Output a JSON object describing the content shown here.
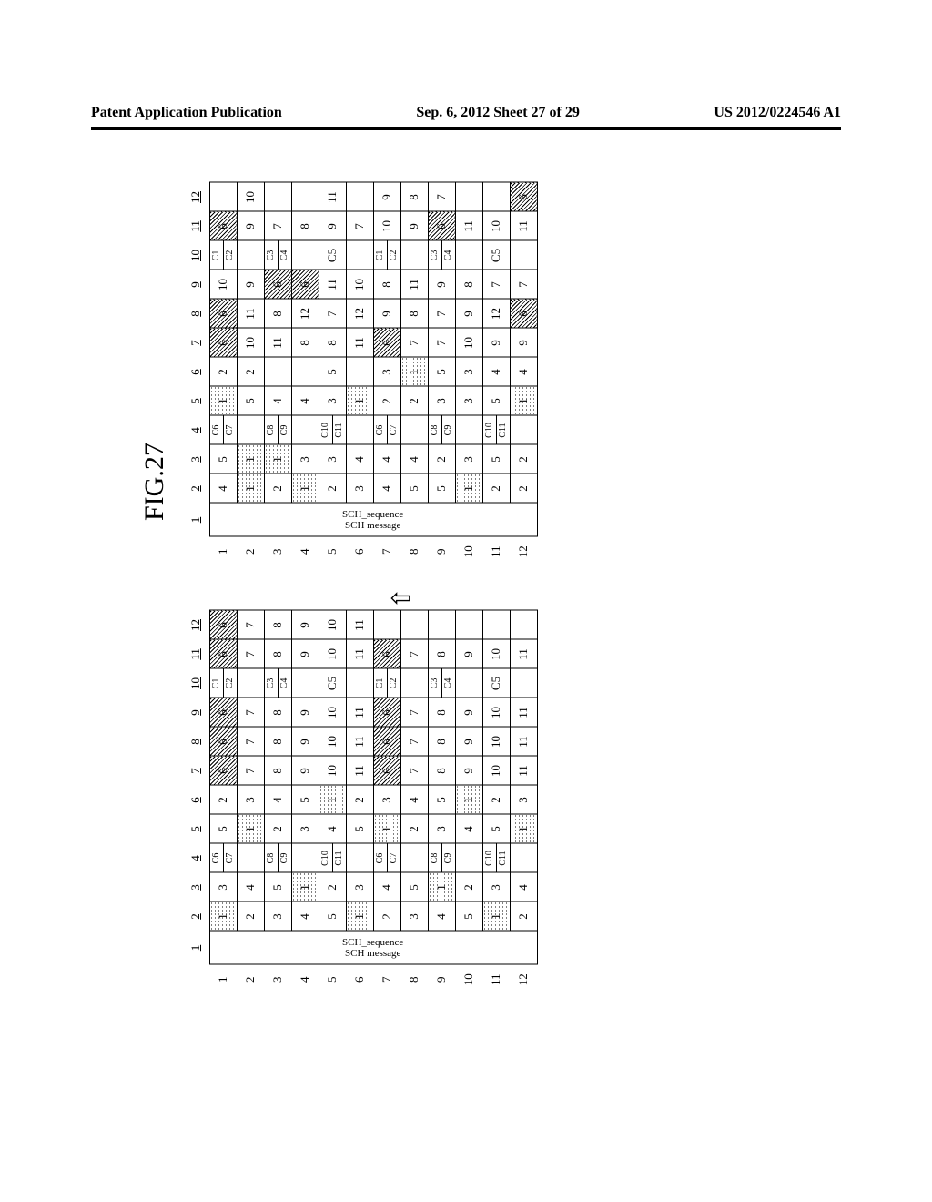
{
  "header": {
    "left": "Patent Application Publication",
    "center": "Sep. 6, 2012   Sheet 27 of 29",
    "right": "US 2012/0224546 A1"
  },
  "figure_label": "FIG.27",
  "arrow_glyph": "⇧",
  "sch_labels": {
    "sequence": "SCH_sequence",
    "message": "SCH message"
  },
  "col_headers": [
    "1",
    "2",
    "3",
    "4",
    "5",
    "6",
    "7",
    "8",
    "9",
    "10",
    "11",
    "12"
  ],
  "row_headers": [
    "1",
    "2",
    "3",
    "4",
    "5",
    "6",
    "7",
    "8",
    "9",
    "10",
    "11",
    "12"
  ],
  "split_col4": [
    "C6",
    "C7",
    "",
    "",
    "C8",
    "C9",
    "",
    "",
    "C10",
    "C11",
    "",
    "",
    "C6",
    "C7",
    "",
    "",
    "C8",
    "C9",
    "",
    "",
    "C10",
    "C11",
    "",
    ""
  ],
  "split_col10": [
    "C1",
    "C2",
    "",
    "",
    "C3",
    "C4",
    "",
    "",
    "C5",
    "",
    "",
    "",
    "C1",
    "C2",
    "",
    "",
    "C3",
    "C4",
    "",
    "",
    "C5",
    "",
    "",
    ""
  ],
  "table_top": {
    "comment": "Lower table in rotated view (first grid from top before arrow)",
    "rows": [
      {
        "c2": "1",
        "c2s": "dotted",
        "c3": "3",
        "c5": "5",
        "c6": "2",
        "c7": "6",
        "c7s": "diag",
        "c8": "6",
        "c8s": "diag",
        "c9": "6",
        "c9s": "diag",
        "c11": "6",
        "c11s": "diag",
        "c12": "6",
        "c12s": "diag"
      },
      {
        "c2": "2",
        "c3": "4",
        "c5": "1",
        "c5s": "dotted",
        "c6": "3",
        "c7": "7",
        "c8": "7",
        "c9": "7",
        "c11": "7",
        "c12": "7"
      },
      {
        "c2": "3",
        "c3": "5",
        "c5": "2",
        "c6": "4",
        "c7": "8",
        "c8": "8",
        "c9": "8",
        "c11": "8",
        "c12": "8"
      },
      {
        "c2": "4",
        "c3": "1",
        "c3s": "dotted",
        "c5": "3",
        "c6": "5",
        "c7": "9",
        "c8": "9",
        "c9": "9",
        "c11": "9",
        "c12": "9"
      },
      {
        "c2": "5",
        "c3": "2",
        "c5": "4",
        "c6": "1",
        "c6s": "dotted",
        "c7": "10",
        "c8": "10",
        "c9": "10",
        "c11": "10",
        "c12": "10"
      },
      {
        "c2": "1",
        "c2s": "dotted",
        "c3": "3",
        "c5": "5",
        "c6": "2",
        "c7": "11",
        "c8": "11",
        "c9": "11",
        "c11": "11",
        "c12": "11"
      },
      {
        "c2": "2",
        "c3": "4",
        "c5": "1",
        "c5s": "dotted",
        "c6": "3",
        "c7": "6",
        "c7s": "diag",
        "c8": "6",
        "c8s": "diag",
        "c9": "6",
        "c9s": "diag",
        "c11": "6",
        "c11s": "diag",
        "c12": ""
      },
      {
        "c2": "3",
        "c3": "5",
        "c5": "2",
        "c6": "4",
        "c7": "7",
        "c8": "7",
        "c9": "7",
        "c11": "7",
        "c12": ""
      },
      {
        "c2": "4",
        "c3": "1",
        "c3s": "dotted",
        "c5": "3",
        "c6": "5",
        "c7": "8",
        "c8": "8",
        "c9": "8",
        "c11": "8",
        "c12": ""
      },
      {
        "c2": "5",
        "c3": "2",
        "c5": "4",
        "c6": "1",
        "c6s": "dotted",
        "c7": "9",
        "c8": "9",
        "c9": "9",
        "c11": "9",
        "c12": ""
      },
      {
        "c2": "1",
        "c2s": "dotted",
        "c3": "3",
        "c5": "5",
        "c6": "2",
        "c7": "10",
        "c8": "10",
        "c9": "10",
        "c11": "10",
        "c12": ""
      },
      {
        "c2": "2",
        "c3": "4",
        "c5": "1",
        "c5s": "dotted",
        "c6": "3",
        "c7": "11",
        "c8": "11",
        "c9": "11",
        "c11": "11",
        "c12": ""
      }
    ]
  },
  "table_bottom": {
    "comment": "Upper table (randomized) after arrow",
    "rows": [
      {
        "c2": "4",
        "c3": "5",
        "c5": "1",
        "c5s": "dotted",
        "c6": "2",
        "c7": "6",
        "c7s": "diag",
        "c8": "6",
        "c8s": "diag",
        "c9": "10",
        "c11": "6",
        "c11s": "diag",
        "c12": ""
      },
      {
        "c2": "1",
        "c2s": "dotted",
        "c3": "1",
        "c3s": "dotted",
        "c5": "5",
        "c6": "2",
        "c7": "10",
        "c8": "11",
        "c9": "9",
        "c11": "9",
        "c12": "10"
      },
      {
        "c2": "2",
        "c3": "1",
        "c3s": "dotted",
        "c5": "4",
        "c6": "",
        "c7": "11",
        "c8": "8",
        "c9": "6",
        "c9s": "diag",
        "c11": "7",
        "c12": ""
      },
      {
        "c2": "1",
        "c2s": "dotted",
        "c3": "3",
        "c5": "4",
        "c6": "",
        "c7": "8",
        "c8": "12",
        "c9": "6",
        "c9s": "diag",
        "c11": "8",
        "c12": ""
      },
      {
        "c2": "2",
        "c3": "3",
        "c5": "3",
        "c6": "5",
        "c7": "8",
        "c8": "7",
        "c9": "11",
        "c11": "9",
        "c12": "11"
      },
      {
        "c2": "3",
        "c3": "4",
        "c5": "1",
        "c5s": "dotted",
        "c6": "",
        "c7": "11",
        "c8": "12",
        "c9": "10",
        "c11": "7",
        "c12": ""
      },
      {
        "c2": "4",
        "c3": "4",
        "c5": "2",
        "c6": "3",
        "c7": "6",
        "c7s": "diag",
        "c8": "9",
        "c9": "8",
        "c11": "10",
        "c12": "9"
      },
      {
        "c2": "5",
        "c3": "4",
        "c5": "2",
        "c6": "1",
        "c6s": "dotted",
        "c7": "7",
        "c8": "8",
        "c9": "11",
        "c11": "9",
        "c12": "8"
      },
      {
        "c2": "5",
        "c3": "2",
        "c5": "3",
        "c6": "5",
        "c7": "7",
        "c8": "7",
        "c9": "9",
        "c11": "6",
        "c11s": "diag",
        "c12": "7"
      },
      {
        "c2": "1",
        "c2s": "dotted",
        "c3": "3",
        "c5": "3",
        "c6": "3",
        "c7": "10",
        "c8": "9",
        "c9": "8",
        "c11": "11",
        "c12": ""
      },
      {
        "c2": "2",
        "c3": "5",
        "c5": "5",
        "c6": "4",
        "c7": "9",
        "c8": "12",
        "c9": "7",
        "c11": "10",
        "c12": ""
      },
      {
        "c2": "2",
        "c3": "2",
        "c5": "1",
        "c5s": "dotted",
        "c6": "4",
        "c7": "9",
        "c8": "6",
        "c8s": "diag",
        "c9": "7",
        "c11": "11",
        "c12": "6",
        "c12s": "diag"
      }
    ]
  }
}
